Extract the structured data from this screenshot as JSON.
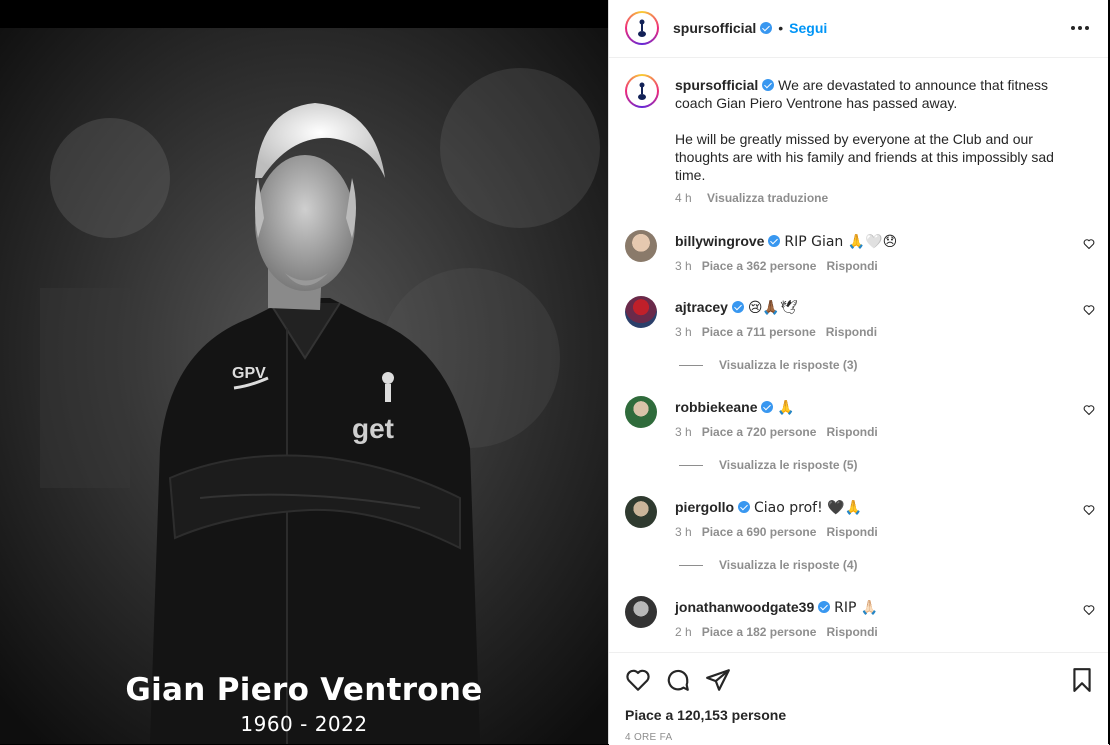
{
  "post": {
    "photo": {
      "caption_name": "Gian Piero Ventrone",
      "caption_years": "1960 - 2022",
      "jacket_initials": "GPV",
      "jacket_sponsor": "get"
    },
    "header": {
      "username": "spursofficial",
      "separator": "•",
      "follow_label": "Segui"
    },
    "caption": {
      "username": "spursofficial",
      "line1": "We are devastated to announce that fitness",
      "line2": "coach Gian Piero Ventrone has passed away.",
      "line3": "He will be greatly missed by everyone at the Club and our",
      "line4": "thoughts are with his family and friends at this impossibly sad",
      "line5": "time.",
      "time": "4 h",
      "translate_label": "Visualizza traduzione"
    },
    "comments": [
      {
        "username": "billywingrove",
        "text": "RIP Gian 🙏🤍😞",
        "time": "3 h",
        "likes": "Piace a 362 persone",
        "reply": "Rispondi",
        "replies": ""
      },
      {
        "username": "ajtracey",
        "text": "😢🙏🏾🕊",
        "time": "3 h",
        "likes": "Piace a 711 persone",
        "reply": "Rispondi",
        "replies": "Visualizza le risposte (3)"
      },
      {
        "username": "robbiekeane",
        "text": "🙏",
        "time": "3 h",
        "likes": "Piace a 720 persone",
        "reply": "Rispondi",
        "replies": "Visualizza le risposte (5)"
      },
      {
        "username": "piergollo",
        "text": "Ciao prof! 🖤🙏",
        "time": "3 h",
        "likes": "Piace a 690 persone",
        "reply": "Rispondi",
        "replies": "Visualizza le risposte (4)"
      },
      {
        "username": "jonathanwoodgate39",
        "text": "RIP 🙏🏻",
        "time": "2 h",
        "likes": "Piace a 182 persone",
        "reply": "Rispondi",
        "replies": ""
      }
    ],
    "footer": {
      "likes_label": "Piace a 120,153 persone",
      "ago": "4 ORE FA"
    },
    "icons": {
      "like": "heart-icon",
      "comment": "comment-icon",
      "share": "paper-plane-icon",
      "save": "bookmark-icon",
      "more": "more-options-icon",
      "verified": "verified-badge-icon"
    },
    "colors": {
      "follow_blue": "#0095f6",
      "verified_blue": "#3897f0",
      "secondary_text": "#8e8e8e",
      "primary_text": "#262626"
    }
  }
}
